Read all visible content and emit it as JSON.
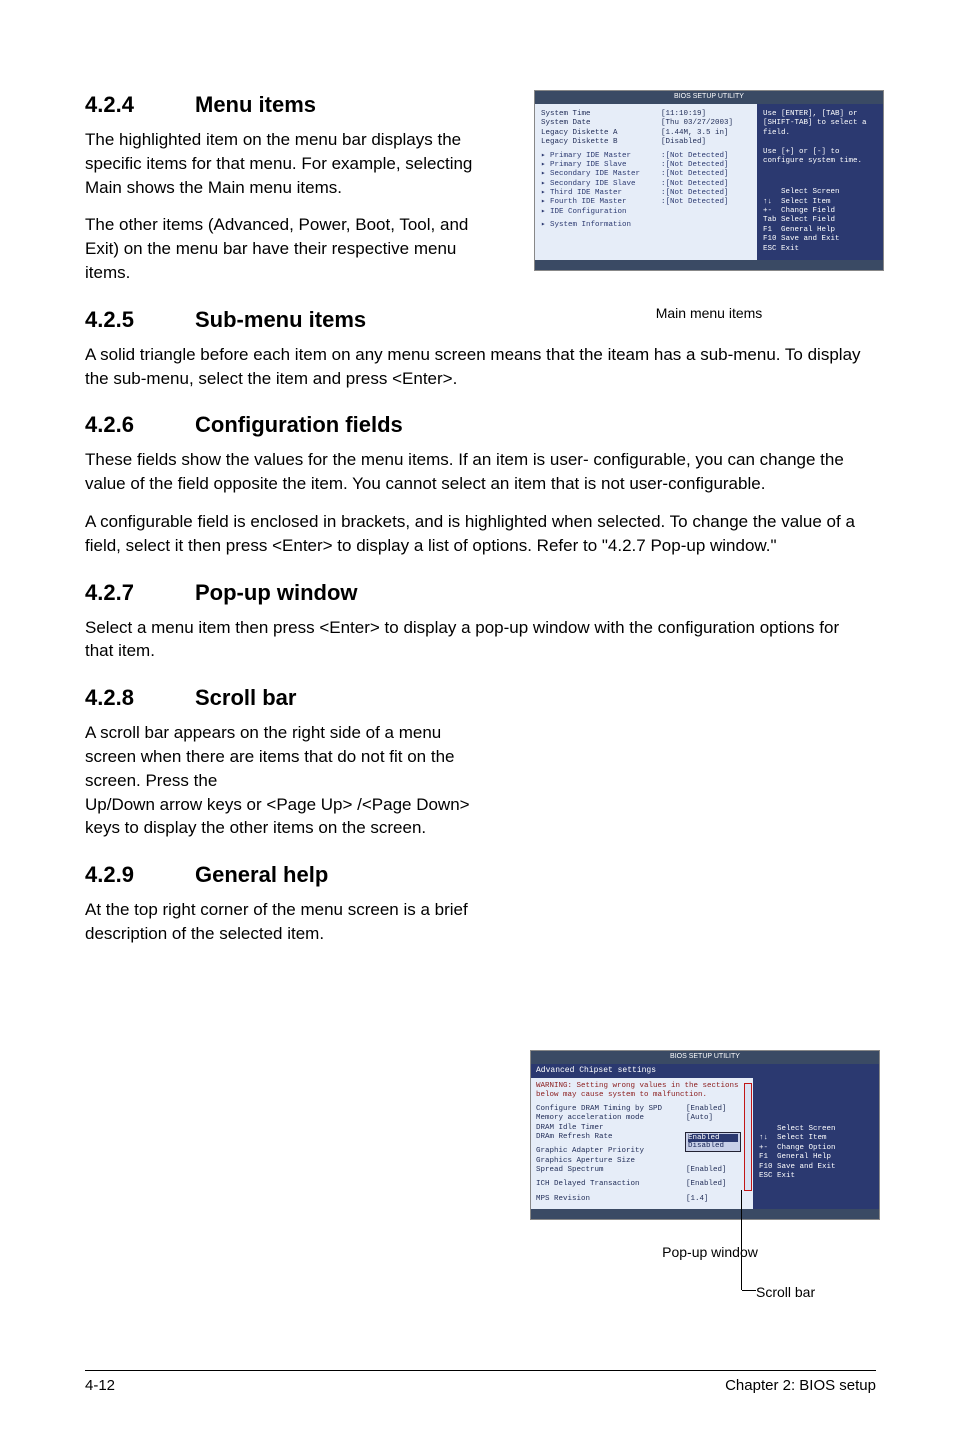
{
  "sections": {
    "s424": {
      "num": "4.2.4",
      "title": "Menu items",
      "p1": "The highlighted item on the menu bar displays the specific items for that menu. For example, selecting Main shows the Main menu items.",
      "p2": "The other items (Advanced, Power, Boot, Tool, and Exit) on the menu bar have their respective menu items."
    },
    "s425": {
      "num": "4.2.5",
      "title": "Sub-menu items",
      "p1": "A solid triangle before each item on any menu screen means that the iteam has a sub-menu. To display the sub-menu, select the item and press <Enter>."
    },
    "s426": {
      "num": "4.2.6",
      "title": "Configuration fields",
      "p1": "These fields show the values for the menu items. If an item is user- configurable, you can change the value of the field opposite the item. You cannot select an item that is not user-configurable.",
      "p2": "A configurable field is enclosed in brackets, and is highlighted when selected. To change the value of a field, select it then press <Enter> to display a list of options. Refer to \"4.2.7 Pop-up window.\""
    },
    "s427": {
      "num": "4.2.7",
      "title": "Pop-up window",
      "p1": "Select a menu item then press <Enter> to display a pop-up window with the configuration options for that item."
    },
    "s428": {
      "num": "4.2.8",
      "title": "Scroll bar",
      "p1": "A scroll bar appears on the right side of a menu screen when there are items that do not fit on the screen. Press the",
      "p2": "Up/Down arrow keys or <Page Up> /<Page Down> keys to display the other items on the screen."
    },
    "s429": {
      "num": "4.2.9",
      "title": "General help",
      "p1": "At the top right corner of the menu screen is a brief description of the selected item."
    }
  },
  "captions": {
    "main": "Main menu items",
    "popup": "Pop-up window",
    "scroll": "Scroll bar"
  },
  "footer": {
    "left": "4-12",
    "right": "Chapter 2: BIOS setup"
  },
  "bios_main": {
    "header": "BIOS SETUP UTILITY",
    "left_lines": [
      {
        "lbl": "System Time",
        "val": "[11:10:19]"
      },
      {
        "lbl": "System Date",
        "val": "[Thu 03/27/2003]"
      },
      {
        "lbl": "Legacy Diskette A",
        "val": "[1.44M, 3.5 in]"
      },
      {
        "lbl": "Legacy Diskette B",
        "val": "[Disabled]"
      }
    ],
    "sub_lines": [
      {
        "lbl": "Primary IDE Master",
        "val": ":[Not Detected]"
      },
      {
        "lbl": "Primary IDE Slave",
        "val": ":[Not Detected]"
      },
      {
        "lbl": "Secondary IDE Master",
        "val": ":[Not Detected]"
      },
      {
        "lbl": "Secondary IDE Slave",
        "val": ":[Not Detected]"
      },
      {
        "lbl": "Third IDE Master",
        "val": ":[Not Detected]"
      },
      {
        "lbl": "Fourth IDE Master",
        "val": ":[Not Detected]"
      },
      {
        "lbl": "IDE Configuration",
        "val": ""
      }
    ],
    "sys_info": "System Information",
    "help_top": "Use [ENTER], [TAB] or [SHIFT-TAB] to select a field.\n\nUse [+] or [-] to configure system time.",
    "help_keys": "    Select Screen\n↑↓  Select Item\n+-  Change Field\nTab Select Field\nF1  General Help\nF10 Save and Exit\nESC Exit"
  },
  "bios_adv": {
    "title": "Advanced Chipset settings",
    "warn": "WARNING: Setting wrong values in the sections below may cause system to malfunction.",
    "lines": [
      {
        "lbl": "Configure DRAM Timing by SPD",
        "val": "[Enabled]"
      },
      {
        "lbl": "Memory acceleration mode",
        "val": "[Auto]"
      },
      {
        "lbl": "DRAM Idle Timer",
        "val": ""
      },
      {
        "lbl": "DRAm Refresh Rate",
        "val": ""
      },
      {
        "lbl": "",
        "val": ""
      },
      {
        "lbl": "Graphic Adapter Priority",
        "val": ""
      },
      {
        "lbl": "Graphics Aperture Size",
        "val": ""
      },
      {
        "lbl": "Spread Spectrum",
        "val": "[Enabled]"
      },
      {
        "lbl": "",
        "val": ""
      },
      {
        "lbl": "ICH Delayed Transaction",
        "val": "[Enabled]"
      },
      {
        "lbl": "",
        "val": ""
      },
      {
        "lbl": "MPS Revision",
        "val": "[1.4]"
      }
    ],
    "popup_opts": [
      "Enabled",
      "Disabled"
    ],
    "help_keys": "    Select Screen\n↑↓  Select Item\n+-  Change Option\nF1  General Help\nF10 Save and Exit\nESC Exit"
  }
}
